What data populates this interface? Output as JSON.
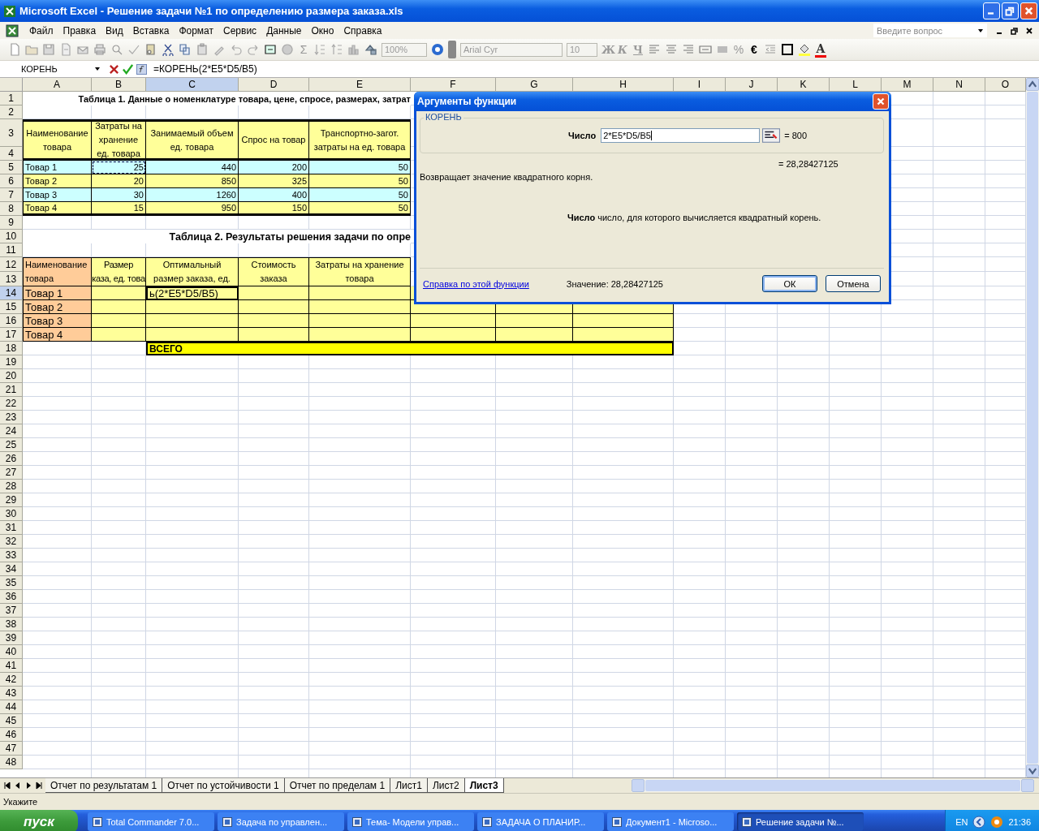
{
  "window": {
    "title": "Microsoft Excel - Решение задачи №1 по определению размера заказа.xls"
  },
  "menu": [
    "Файл",
    "Правка",
    "Вид",
    "Вставка",
    "Формат",
    "Сервис",
    "Данные",
    "Окно",
    "Справка"
  ],
  "help_box": {
    "placeholder": "Введите вопрос"
  },
  "toolbar": {
    "sum": "Σ",
    "zoom": "100%",
    "font": "Arial Cyr",
    "size": "10",
    "style_buttons": [
      "Ж",
      "К",
      "Ч"
    ],
    "number_buttons": [
      "%",
      "€"
    ],
    "font_color": "A"
  },
  "formula_bar": {
    "name_box": "КОРЕНЬ",
    "formula": "=КОРЕНЬ(2*E5*D5/B5)"
  },
  "columns": [
    {
      "label": "A",
      "selected": false
    },
    {
      "label": "B",
      "selected": false
    },
    {
      "label": "C",
      "selected": true
    },
    {
      "label": "D",
      "selected": false
    },
    {
      "label": "E",
      "selected": false
    },
    {
      "label": "F",
      "selected": false
    },
    {
      "label": "G",
      "selected": false
    },
    {
      "label": "H",
      "selected": false
    },
    {
      "label": "I",
      "selected": false
    },
    {
      "label": "J",
      "selected": false
    },
    {
      "label": "K",
      "selected": false
    },
    {
      "label": "L",
      "selected": false
    },
    {
      "label": "M",
      "selected": false
    },
    {
      "label": "N",
      "selected": false
    },
    {
      "label": "O",
      "selected": false
    }
  ],
  "rows": [
    {
      "label": "1",
      "selected": false
    },
    {
      "label": "2",
      "selected": false
    },
    {
      "label": "3",
      "selected": false
    },
    {
      "label": "4",
      "selected": false
    },
    {
      "label": "5",
      "selected": false
    },
    {
      "label": "6",
      "selected": false
    },
    {
      "label": "7",
      "selected": false
    },
    {
      "label": "8",
      "selected": false
    },
    {
      "label": "9",
      "selected": false
    },
    {
      "label": "10",
      "selected": false
    },
    {
      "label": "11",
      "selected": false
    },
    {
      "label": "12",
      "selected": false
    },
    {
      "label": "13",
      "selected": false
    },
    {
      "label": "14",
      "selected": true
    },
    {
      "label": "15",
      "selected": false
    },
    {
      "label": "16",
      "selected": false
    },
    {
      "label": "17",
      "selected": false
    },
    {
      "label": "18",
      "selected": false
    },
    {
      "label": "19",
      "selected": false
    },
    {
      "label": "20",
      "selected": false
    },
    {
      "label": "21",
      "selected": false
    },
    {
      "label": "22",
      "selected": false
    },
    {
      "label": "23",
      "selected": false
    },
    {
      "label": "24",
      "selected": false
    },
    {
      "label": "25",
      "selected": false
    },
    {
      "label": "26",
      "selected": false
    },
    {
      "label": "27",
      "selected": false
    },
    {
      "label": "28",
      "selected": false
    },
    {
      "label": "29",
      "selected": false
    },
    {
      "label": "30",
      "selected": false
    },
    {
      "label": "31",
      "selected": false
    },
    {
      "label": "32",
      "selected": false
    },
    {
      "label": "33",
      "selected": false
    },
    {
      "label": "34",
      "selected": false
    },
    {
      "label": "35",
      "selected": false
    },
    {
      "label": "36",
      "selected": false
    },
    {
      "label": "37",
      "selected": false
    },
    {
      "label": "38",
      "selected": false
    },
    {
      "label": "39",
      "selected": false
    },
    {
      "label": "40",
      "selected": false
    },
    {
      "label": "41",
      "selected": false
    },
    {
      "label": "42",
      "selected": false
    },
    {
      "label": "43",
      "selected": false
    },
    {
      "label": "44",
      "selected": false
    },
    {
      "label": "45",
      "selected": false
    },
    {
      "label": "46",
      "selected": false
    },
    {
      "label": "47",
      "selected": false
    },
    {
      "label": "48",
      "selected": false
    }
  ],
  "table1": {
    "title": "Таблица 1. Данные о номенклатуре товара, цене, спросе, размерах, затрат",
    "headers": [
      "Наименование\nтовара",
      "Затраты на\nхранение\nед. товара",
      "Занимаемый объем\nед. товара",
      "Спрос на товар",
      "Транспортно-загот.\nзатраты на ед. товара"
    ],
    "rows": [
      {
        "name": "Товар 1",
        "values": [
          "25",
          "440",
          "200",
          "50"
        ],
        "color": "#ccffff",
        "marked": true
      },
      {
        "name": "Товар 2",
        "values": [
          "20",
          "850",
          "325",
          "50"
        ],
        "color": "#ffff99",
        "marked": false
      },
      {
        "name": "Товар 3",
        "values": [
          "30",
          "1260",
          "400",
          "50"
        ],
        "color": "#ccffff",
        "marked": false
      },
      {
        "name": "Товар 4",
        "values": [
          "15",
          "950",
          "150",
          "50"
        ],
        "color": "#ffff99",
        "marked": false
      }
    ]
  },
  "table2": {
    "title": "Таблица 2. Результаты решения задачи по опре",
    "headers": [
      "Наименование\nтовара",
      "Размер\nказа, ед. това",
      "Оптимальный\nразмер заказа, ед.",
      "Стоимость\nзаказа",
      "Затраты на хранение\nтовара"
    ],
    "rows": [
      {
        "name": "Товар 1",
        "editing": "ь(2*E5*D5/B5)"
      },
      {
        "name": "Товар 2"
      },
      {
        "name": "Товар 3"
      },
      {
        "name": "Товар 4"
      }
    ],
    "total_label": "ВСЕГО"
  },
  "dialog": {
    "title": "Аргументы функции",
    "function": "КОРЕНЬ",
    "arg_label": "Число",
    "arg_value": "2*E5*D5/B5",
    "arg_result": "= 800",
    "result": "= 28,28427125",
    "description": "Возвращает значение квадратного корня.",
    "arg_help": "**Число**  число, для которого вычисляется квадратный корень.",
    "help_link": "Справка по этой функции",
    "value": "Значение: 28,28427125",
    "ok": "ОК",
    "cancel": "Отмена"
  },
  "sheet_tabs": [
    {
      "label": "Отчет по результатам 1",
      "selected": false
    },
    {
      "label": "Отчет по устойчивости 1",
      "selected": false
    },
    {
      "label": "Отчет по пределам 1",
      "selected": false
    },
    {
      "label": "Лист1",
      "selected": false
    },
    {
      "label": "Лист2",
      "selected": false
    },
    {
      "label": "Лист3",
      "selected": true
    }
  ],
  "status": "Укажите",
  "taskbar": {
    "start": "пуск",
    "items": [
      {
        "label": "Total Commander 7.0...",
        "selected": false
      },
      {
        "label": "Задача по управлен...",
        "selected": false
      },
      {
        "label": "Тема- Модели управ...",
        "selected": false
      },
      {
        "label": "ЗАДАЧА О ПЛАНИР...",
        "selected": false
      },
      {
        "label": "Документ1 - Microso...",
        "selected": false
      },
      {
        "label": "Решение задачи №...",
        "selected": true
      }
    ],
    "language": "EN",
    "clock": "21:36"
  }
}
